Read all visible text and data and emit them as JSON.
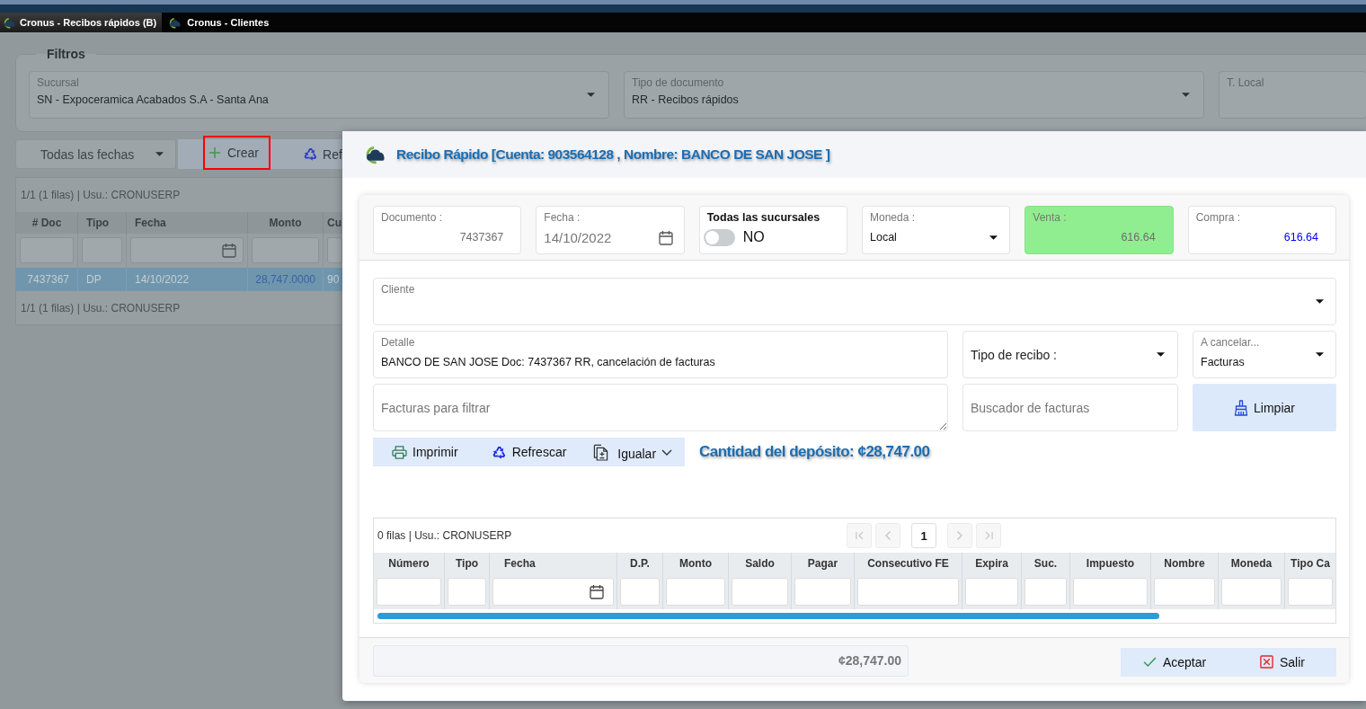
{
  "tabs": [
    {
      "label": "Cronus - Recibos rápidos (B)",
      "selected": true
    },
    {
      "label": "Cronus - Clientes",
      "selected": false
    }
  ],
  "filters": {
    "title": "Filtros",
    "fields": [
      {
        "kind": "dropdown",
        "label": "Sucursal",
        "value": "SN - Expoceramica Acabados S.A - Santa Ana"
      },
      {
        "kind": "dropdown",
        "label": "Tipo de documento",
        "value": "RR - Recibos rápidos"
      },
      {
        "kind": "text",
        "label": "T. Local"
      }
    ]
  },
  "toolbar": {
    "date_filter": "Todas las fechas",
    "buttons": [
      {
        "label": "Crear",
        "highlighted": true
      },
      {
        "label": "Ref",
        "highlighted": false
      }
    ]
  },
  "grid": {
    "status": "1/1 (1 filas) | Usu.: CRONUSERP",
    "columns": [
      {
        "label": "# Doc",
        "kind": "code"
      },
      {
        "label": "Tipo",
        "kind": "text"
      },
      {
        "label": "Fecha",
        "kind": "date"
      },
      {
        "label": "Monto",
        "kind": "amount"
      },
      {
        "label": "Cu",
        "kind": "text"
      }
    ],
    "rows": [
      {
        "selected": true,
        "cells": [
          "7437367",
          "DP",
          "14/10/2022",
          "28,747.0000",
          "90"
        ]
      }
    ],
    "footer": "1/1 (1 filas) | Usu.: CRONUSERP"
  },
  "dialog": {
    "title": "Recibo Rápido [Cuenta: 903564128 , Nombre: BANCO DE SAN JOSE ]",
    "header_fields": [
      {
        "kind": "text",
        "label": "Documento :",
        "value": "7437367"
      },
      {
        "kind": "date",
        "label": "Fecha :",
        "value": "14/10/2022"
      },
      {
        "kind": "toggle",
        "label": "Todas las sucursales",
        "on": false,
        "value": "NO"
      },
      {
        "kind": "dropdown",
        "label": "Moneda :",
        "value": "Local"
      },
      {
        "kind": "rate",
        "label": "Venta :",
        "value": "616.64",
        "highlighted": true
      },
      {
        "kind": "rate",
        "label": "Compra :",
        "value": "616.64",
        "highlighted": false
      }
    ],
    "client": {
      "label": "Cliente"
    },
    "detail": {
      "label": "Detalle",
      "value": "BANCO DE SAN JOSE Doc: 7437367 RR, cancelación de facturas"
    },
    "receipt_type": {
      "label": "Tipo de recibo :"
    },
    "to_cancel": {
      "label": "A cancelar...",
      "value": "Facturas"
    },
    "invoice_filter": {
      "placeholder": "Facturas para filtrar"
    },
    "invoice_search": {
      "placeholder": "Buscador de facturas"
    },
    "clear_button": {
      "label": "Limpiar"
    },
    "actions": [
      {
        "label": "Imprimir",
        "menu": false
      },
      {
        "label": "Refrescar",
        "menu": false
      },
      {
        "label": "Igualar",
        "menu": true
      }
    ],
    "deposit_amount": "Cantidad del depósito: ¢28,747.00",
    "invoice_grid": {
      "status": "0 filas | Usu.: CRONUSERP",
      "pager": {
        "page": "1",
        "disabled": true
      },
      "columns": [
        {
          "label": "Número",
          "kind": "text"
        },
        {
          "label": "Tipo",
          "kind": "text"
        },
        {
          "label": "Fecha",
          "kind": "date"
        },
        {
          "label": "D.P.",
          "kind": "text"
        },
        {
          "label": "Monto",
          "kind": "text"
        },
        {
          "label": "Saldo",
          "kind": "text"
        },
        {
          "label": "Pagar",
          "kind": "text"
        },
        {
          "label": "Consecutivo FE",
          "kind": "text"
        },
        {
          "label": "Expira",
          "kind": "text"
        },
        {
          "label": "Suc.",
          "kind": "text"
        },
        {
          "label": "Impuesto",
          "kind": "text"
        },
        {
          "label": "Nombre",
          "kind": "text"
        },
        {
          "label": "Moneda",
          "kind": "text"
        },
        {
          "label": "Tipo Ca",
          "kind": "text"
        }
      ]
    },
    "total": "¢28,747.00",
    "buttons": [
      {
        "label": "Aceptar"
      },
      {
        "label": "Salir"
      }
    ]
  }
}
